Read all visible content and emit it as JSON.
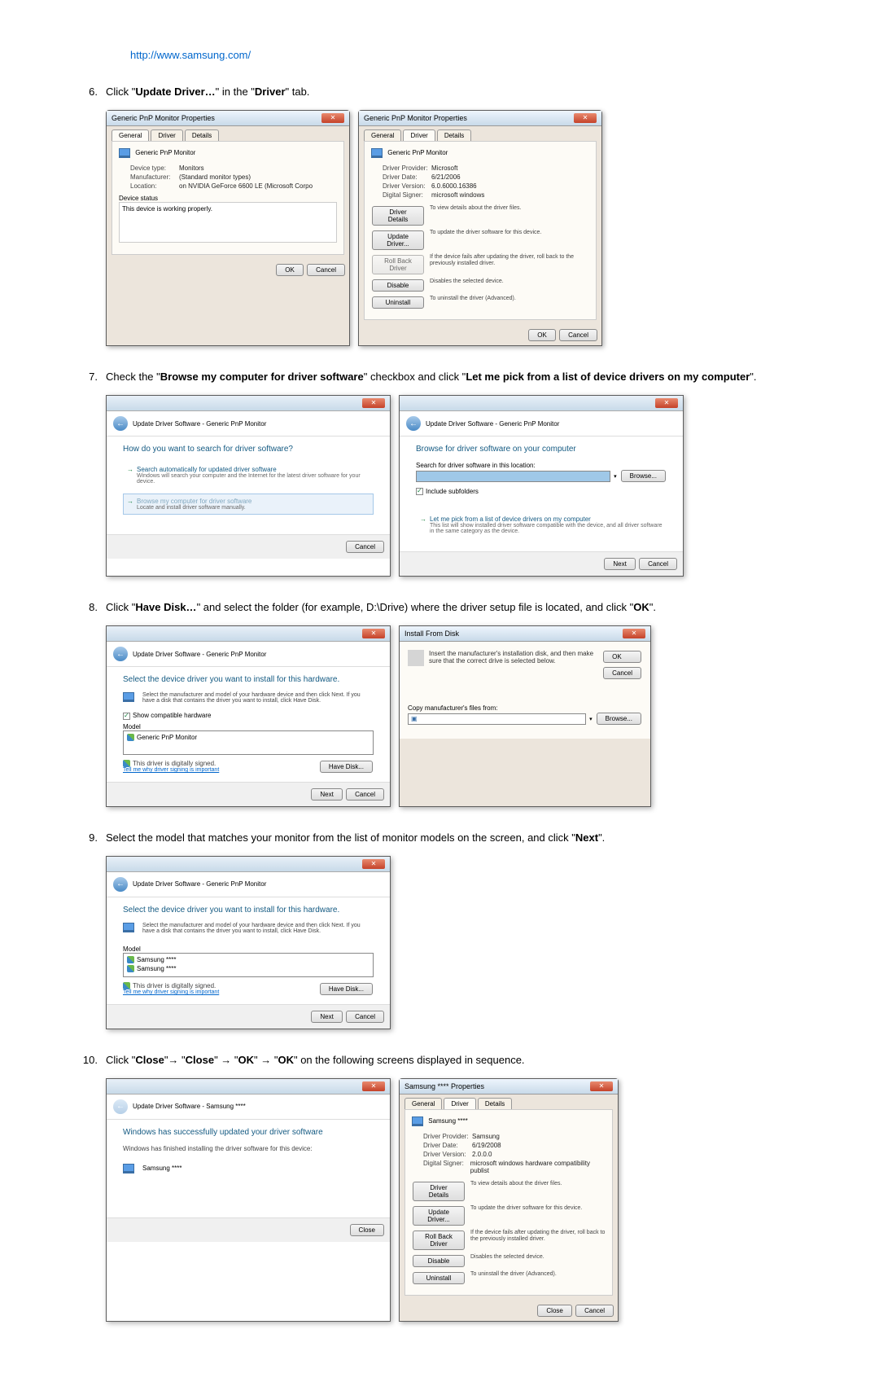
{
  "url": "http://www.samsung.com/",
  "steps": {
    "6": {
      "num": "6.",
      "text_pre": "Click \"",
      "bold1": "Update Driver…",
      "text_mid": "\" in the \"",
      "bold2": "Driver",
      "text_post": "\" tab."
    },
    "7": {
      "num": "7.",
      "text_pre": "Check the \"",
      "bold1": "Browse my computer for driver software",
      "text_mid": "\" checkbox and click \"",
      "bold2": "Let me pick from a list of device drivers on my computer",
      "text_post": "\"."
    },
    "8": {
      "num": "8.",
      "text_pre": "Click \"",
      "bold1": "Have Disk…",
      "text_mid": "\" and select the folder (for example, D:\\Drive) where the driver setup file is located, and click \"",
      "bold2": "OK",
      "text_post": "\"."
    },
    "9": {
      "num": "9.",
      "text_pre": "Select the model that matches your monitor from the list of monitor models on the screen, and click \"",
      "bold1": "Next",
      "text_post": "\"."
    },
    "10": {
      "num": "10.",
      "text_pre": "Click \"",
      "bold1": "Close",
      "text_a": "\"→ \"",
      "bold2": "Close",
      "text_b": "\" → \"",
      "bold3": "OK",
      "text_c": "\" → \"",
      "bold4": "OK",
      "text_post": "\" on the following screens displayed in sequence."
    }
  },
  "dlg_props": {
    "title": "Generic PnP Monitor Properties",
    "tab_general": "General",
    "tab_driver": "Driver",
    "tab_details": "Details",
    "device_name": "Generic PnP Monitor",
    "general": {
      "devtype_l": "Device type:",
      "devtype_v": "Monitors",
      "mfr_l": "Manufacturer:",
      "mfr_v": "(Standard monitor types)",
      "loc_l": "Location:",
      "loc_v": "on NVIDIA GeForce 6600 LE (Microsoft Corpo",
      "status_h": "Device status",
      "status_v": "This device is working properly."
    },
    "driver": {
      "prov_l": "Driver Provider:",
      "prov_v": "Microsoft",
      "date_l": "Driver Date:",
      "date_v": "6/21/2006",
      "ver_l": "Driver Version:",
      "ver_v": "6.0.6000.16386",
      "sign_l": "Digital Signer:",
      "sign_v": "microsoft windows",
      "details_btn": "Driver Details",
      "details_d": "To view details about the driver files.",
      "update_btn": "Update Driver...",
      "update_d": "To update the driver software for this device.",
      "rollback_btn": "Roll Back Driver",
      "rollback_d": "If the device fails after updating the driver, roll back to the previously installed driver.",
      "disable_btn": "Disable",
      "disable_d": "Disables the selected device.",
      "uninstall_btn": "Uninstall",
      "uninstall_d": "To uninstall the driver (Advanced)."
    },
    "ok": "OK",
    "cancel": "Cancel"
  },
  "wiz_search": {
    "breadcrumb": "Update Driver Software - Generic PnP Monitor",
    "heading": "How do you want to search for driver software?",
    "opt1_t": "Search automatically for updated driver software",
    "opt1_d": "Windows will search your computer and the Internet for the latest driver software for your device.",
    "opt2_t": "Browse my computer for driver software",
    "opt2_d": "Locate and install driver software manually.",
    "cancel": "Cancel"
  },
  "wiz_browse": {
    "heading": "Browse for driver software on your computer",
    "search_l": "Search for driver software in this location:",
    "browse_btn": "Browse...",
    "include_cb": "Include subfolders",
    "opt_t": "Let me pick from a list of device drivers on my computer",
    "opt_d": "This list will show installed driver software compatible with the device, and all driver software in the same category as the device.",
    "next": "Next",
    "cancel": "Cancel"
  },
  "wiz_select": {
    "heading": "Select the device driver you want to install for this hardware.",
    "instr": "Select the manufacturer and model of your hardware device and then click Next. If you have a disk that contains the driver you want to install, click Have Disk.",
    "compat_cb": "Show compatible hardware",
    "model_h": "Model",
    "model_1": "Generic PnP Monitor",
    "signed": "This driver is digitally signed.",
    "why_link": "Tell me why driver signing is important",
    "have_disk": "Have Disk...",
    "next": "Next",
    "cancel": "Cancel"
  },
  "install_disk": {
    "title": "Install From Disk",
    "text": "Insert the manufacturer's installation disk, and then make sure that the correct drive is selected below.",
    "ok": "OK",
    "cancel": "Cancel",
    "copy_l": "Copy manufacturer's files from:",
    "browse": "Browse..."
  },
  "wiz_select2": {
    "heading": "Select the device driver you want to install for this hardware.",
    "instr": "Select the manufacturer and model of your hardware device and then click Next. If you have a disk that contains the driver you want to install, click Have Disk.",
    "model_h": "Model",
    "model_1": "Samsung ****",
    "model_2": "Samsung ****",
    "signed": "This driver is digitally signed.",
    "why_link": "Tell me why driver signing is important",
    "have_disk": "Have Disk...",
    "next": "Next",
    "cancel": "Cancel"
  },
  "wiz_done": {
    "breadcrumb": "Update Driver Software - Samsung ****",
    "heading": "Windows has successfully updated your driver software",
    "text": "Windows has finished installing the driver software for this device:",
    "device": "Samsung ****",
    "close": "Close"
  },
  "dlg_props2": {
    "title": "Samsung **** Properties",
    "device_name": "Samsung ****",
    "prov_v": "Samsung",
    "date_v": "6/19/2008",
    "ver_v": "2.0.0.0",
    "sign_v": "microsoft windows hardware compatibility publist",
    "close": "Close",
    "cancel": "Cancel"
  }
}
